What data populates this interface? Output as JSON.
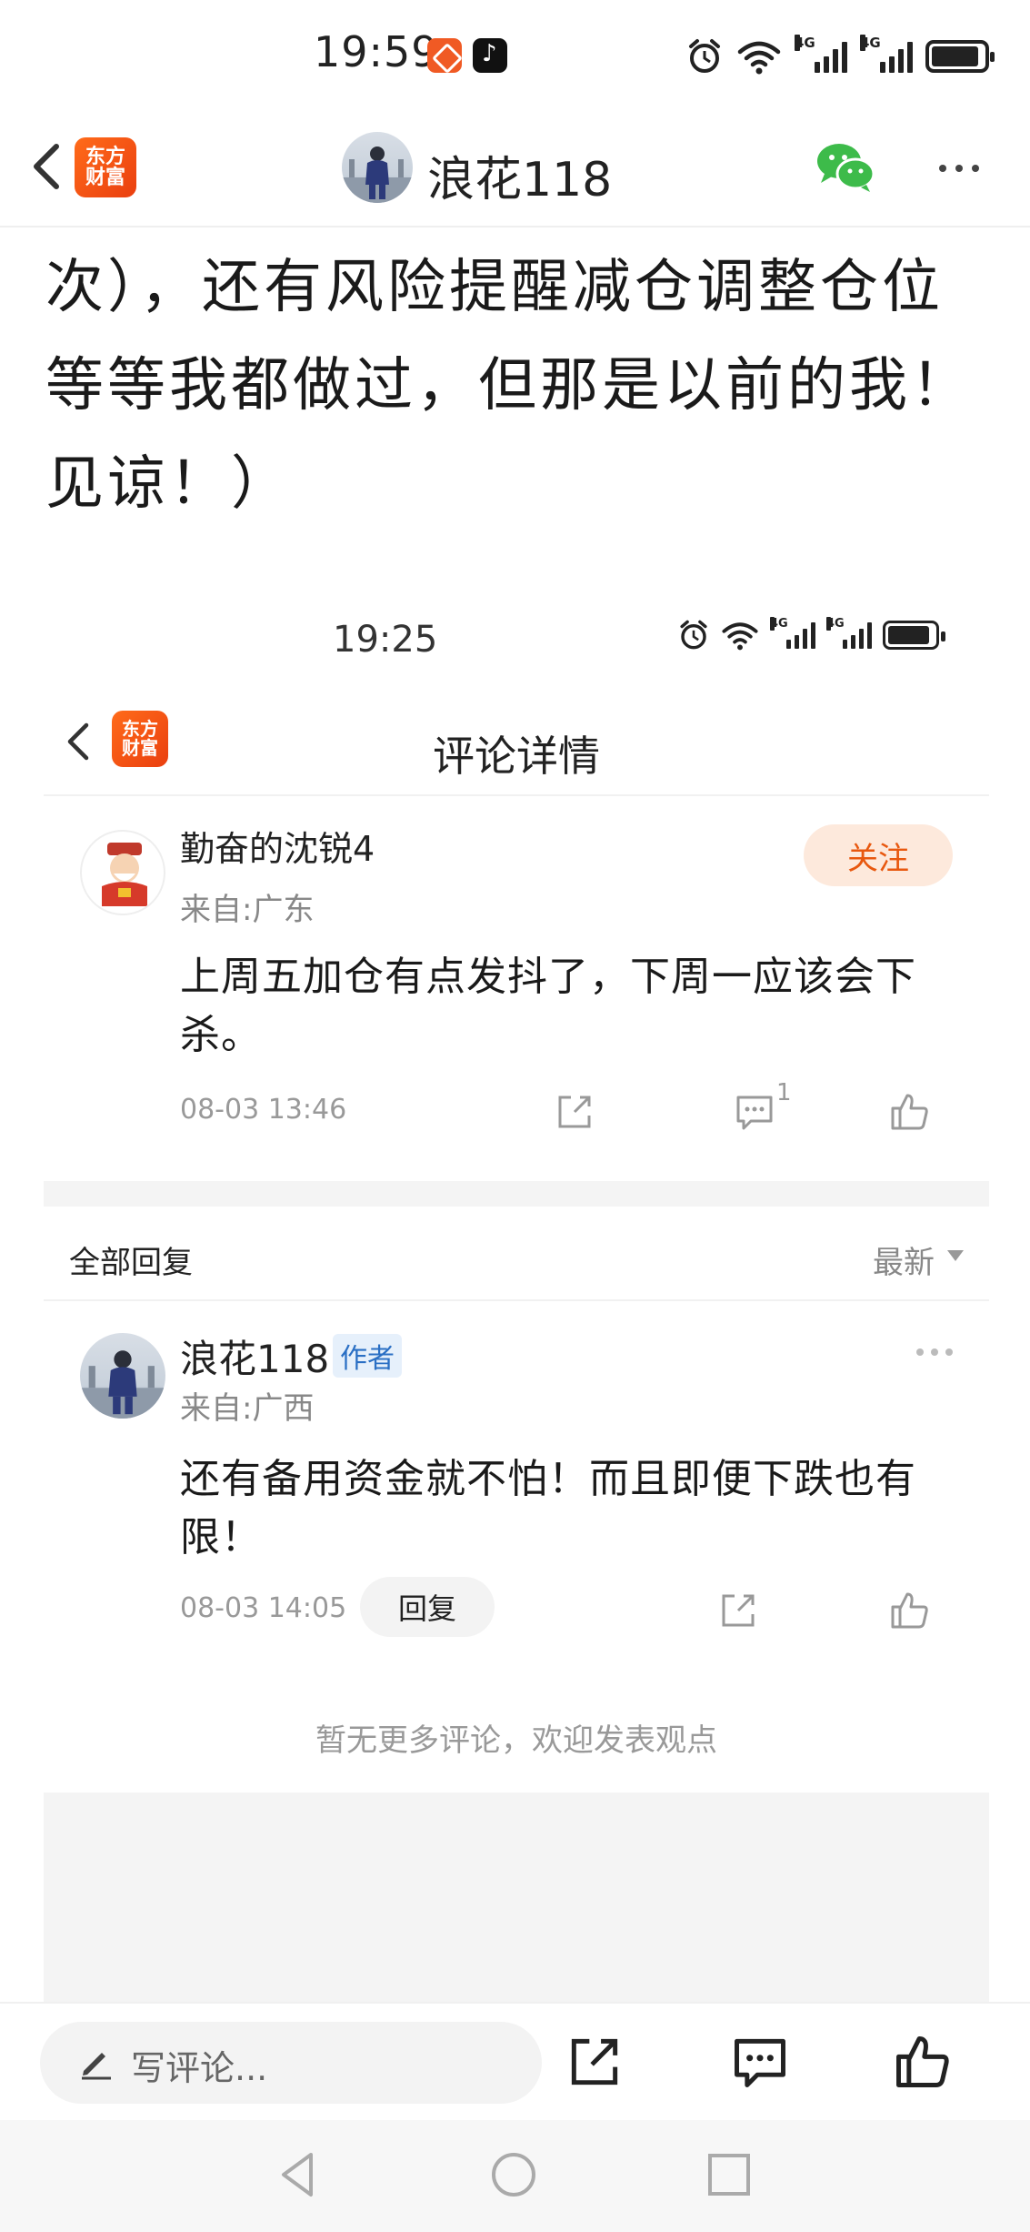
{
  "status_bar": {
    "time": "19:59",
    "net_a": "4G",
    "net_b": "4G"
  },
  "nav": {
    "logo_line1": "东方",
    "logo_line2": "财富",
    "title": "浪花118"
  },
  "article": {
    "lines": [
      "次），还有风险提醒减仓调整仓位",
      "等等我都做过，但那是以前的我！",
      "见谅！）"
    ]
  },
  "embedded": {
    "status": {
      "time": "19:25",
      "net_a": "4G",
      "net_b": "4G"
    },
    "header": {
      "logo_line1": "东方",
      "logo_line2": "财富",
      "title": "评论详情"
    },
    "comment": {
      "author": "勤奋的沈锐4",
      "from": "来自:广东",
      "follow": "关注",
      "text": "上周五加仓有点发抖了，下周一应该会下杀。",
      "date": "08-03 13:46",
      "reply_count": "1"
    },
    "replies_header": {
      "label": "全部回复",
      "sort": "最新"
    },
    "reply": {
      "author": "浪花118",
      "author_tag": "作者",
      "from": "来自:广西",
      "text": "还有备用资金就不怕！而且即便下跌也有限！",
      "date": "08-03 14:05",
      "reply_button": "回复"
    },
    "no_more": "暂无更多评论，欢迎发表观点"
  },
  "bottom_bar": {
    "write_placeholder": "写评论..."
  },
  "colors": {
    "brand_orange": "#f05a24",
    "follow_text": "#e8580f",
    "author_tag_blue": "#2a6fc4",
    "wechat_green": "#3dbb4a"
  }
}
